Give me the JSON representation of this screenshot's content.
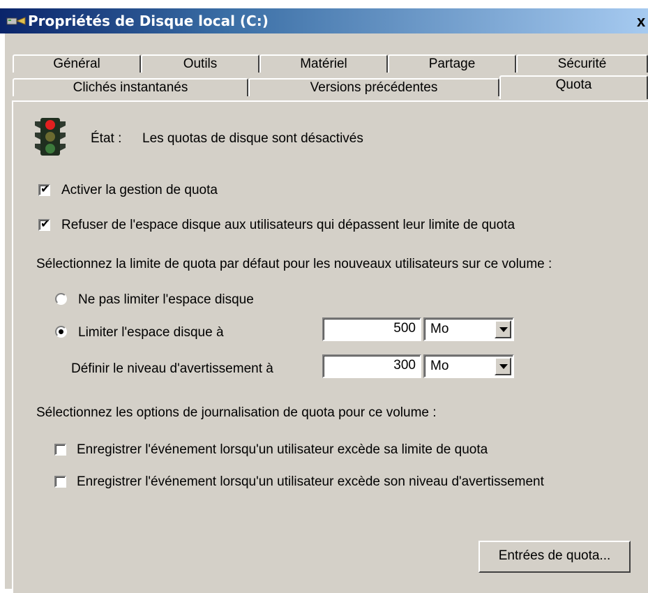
{
  "window": {
    "title": "Propriétés de Disque local (C:)",
    "close_glyph": "x",
    "icon": "drive-properties-icon"
  },
  "tabs_row1": [
    "Général",
    "Outils",
    "Matériel",
    "Partage",
    "Sécurité"
  ],
  "tabs_row2": [
    "Clichés instantanés",
    "Versions précédentes",
    "Quota"
  ],
  "active_tab": "Quota",
  "status": {
    "label": "État :",
    "text": "Les quotas de disque sont désactivés",
    "icon": "traffic-light-icon"
  },
  "options": {
    "enable_quota": {
      "label": "Activer la gestion de quota",
      "checked": true
    },
    "deny_space": {
      "label": "Refuser de l'espace disque aux utilisateurs qui dépassent leur limite de quota",
      "checked": true
    }
  },
  "limit_section": {
    "heading": "Sélectionnez la limite de quota par défaut pour les nouveaux utilisateurs sur ce volume :",
    "no_limit": {
      "label": "Ne pas limiter l'espace disque",
      "selected": false
    },
    "limit": {
      "label": "Limiter l'espace disque à",
      "selected": true,
      "value": "500",
      "unit": "Mo"
    },
    "warning": {
      "label": "Définir le niveau d'avertissement à",
      "value": "300",
      "unit": "Mo"
    }
  },
  "logging_section": {
    "heading": "Sélectionnez les options de journalisation de quota pour ce volume :",
    "log_limit": {
      "label": "Enregistrer l'événement lorsqu'un utilisateur excède sa limite de quota",
      "checked": false
    },
    "log_warning": {
      "label": "Enregistrer l'événement lorsqu'un utilisateur excède son niveau d'avertissement",
      "checked": false
    }
  },
  "buttons": {
    "quota_entries": "Entrées de quota..."
  },
  "colors": {
    "dialog_bg": "#d4d0c8",
    "titlebar_start": "#0a246a",
    "titlebar_end": "#a6caf0"
  }
}
